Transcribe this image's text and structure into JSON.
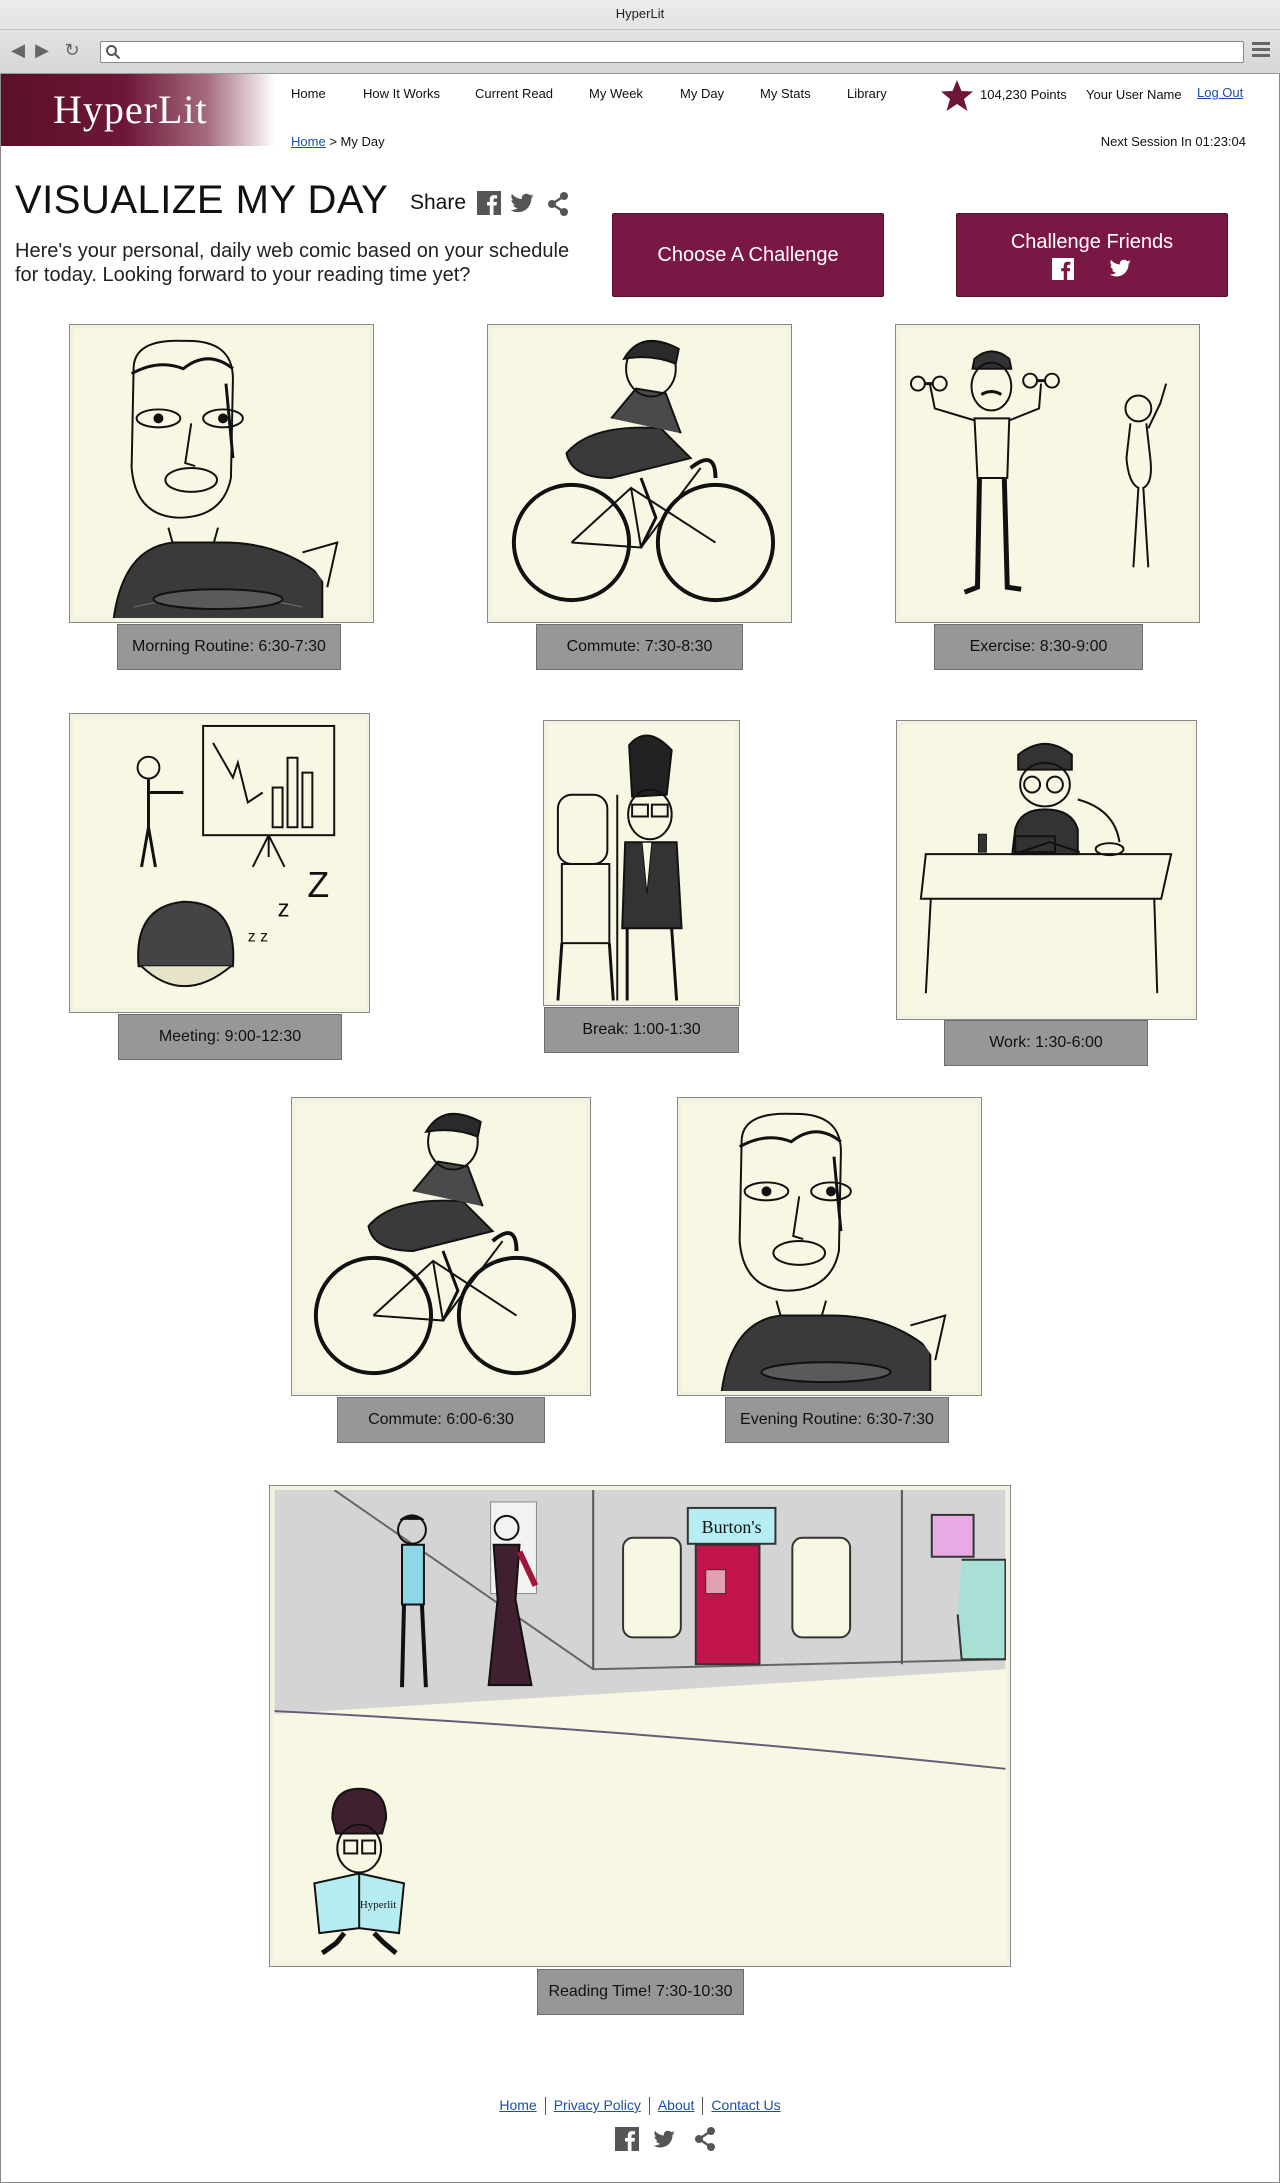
{
  "browser": {
    "title": "HyperLit",
    "url": ""
  },
  "brand": {
    "logo_text": "HyperLit",
    "accent_color": "#7a1845"
  },
  "nav": {
    "items": [
      {
        "label": "Home"
      },
      {
        "label": "How It Works"
      },
      {
        "label": "Current Read"
      },
      {
        "label": "My Week"
      },
      {
        "label": "My Day"
      },
      {
        "label": "My Stats"
      },
      {
        "label": "Library"
      }
    ]
  },
  "account": {
    "points": "104,230 Points",
    "username": "Your User Name",
    "logout": "Log Out"
  },
  "breadcrumb": {
    "home": "Home",
    "separator": ">",
    "current": "My Day"
  },
  "session": {
    "next": "Next Session In 01:23:04"
  },
  "page": {
    "title": "VISUALIZE MY DAY",
    "share_label": "Share",
    "intro": "Here's your personal, daily web comic based on your schedule for today. Looking forward to your reading time yet?"
  },
  "actions": {
    "choose_challenge": "Choose A Challenge",
    "challenge_friends": "Challenge Friends"
  },
  "comic_panels": [
    {
      "caption": "Morning Routine: 6:30-7:30",
      "icon": "person-eating-icon"
    },
    {
      "caption": "Commute: 7:30-8:30",
      "icon": "cyclist-icon"
    },
    {
      "caption": "Exercise: 8:30-9:00",
      "icon": "dumbbells-icon"
    },
    {
      "caption": "Meeting: 9:00-12:30",
      "icon": "presentation-icon"
    },
    {
      "caption": "Break: 1:00-1:30",
      "icon": "water-cooler-icon"
    },
    {
      "caption": "Work: 1:30-6:00",
      "icon": "desk-icon"
    },
    {
      "caption": "Commute: 6:00-6:30",
      "icon": "cyclist-icon"
    },
    {
      "caption": "Evening Routine: 6:30-7:30",
      "icon": "person-eating-icon"
    },
    {
      "caption": "Reading Time! 7:30-10:30",
      "icon": "reading-person-icon",
      "sign": "Burton's",
      "newspaper": "Hyperlit"
    }
  ],
  "footer": {
    "links": [
      {
        "label": "Home"
      },
      {
        "label": "Privacy Policy"
      },
      {
        "label": "About"
      },
      {
        "label": "Contact Us"
      }
    ]
  }
}
